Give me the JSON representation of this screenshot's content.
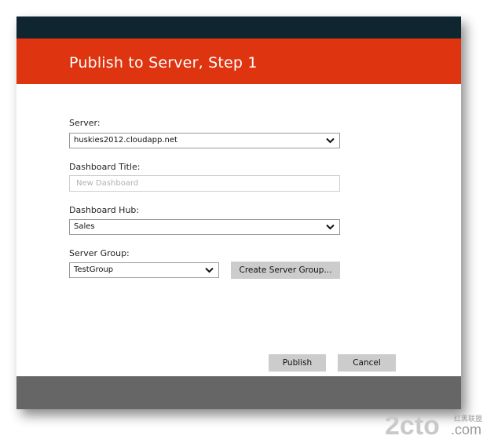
{
  "dialog": {
    "title": "Publish to Server, Step 1"
  },
  "form": {
    "server": {
      "label": "Server:",
      "value": "huskies2012.cloudapp.net"
    },
    "dashboard_title": {
      "label": "Dashboard Title:",
      "value": "",
      "placeholder": "New Dashboard"
    },
    "dashboard_hub": {
      "label": "Dashboard Hub:",
      "value": "Sales"
    },
    "server_group": {
      "label": "Server Group:",
      "value": "TestGroup",
      "create_button_label": "Create Server Group..."
    }
  },
  "actions": {
    "publish_label": "Publish",
    "cancel_label": "Cancel"
  },
  "watermark": {
    "main": "2cto",
    "suffix": ".com",
    "cjk": "红黑联盟"
  },
  "colors": {
    "header": "#de3410",
    "topbar": "#0f2630",
    "footer": "#666666",
    "button": "#cccccc"
  }
}
